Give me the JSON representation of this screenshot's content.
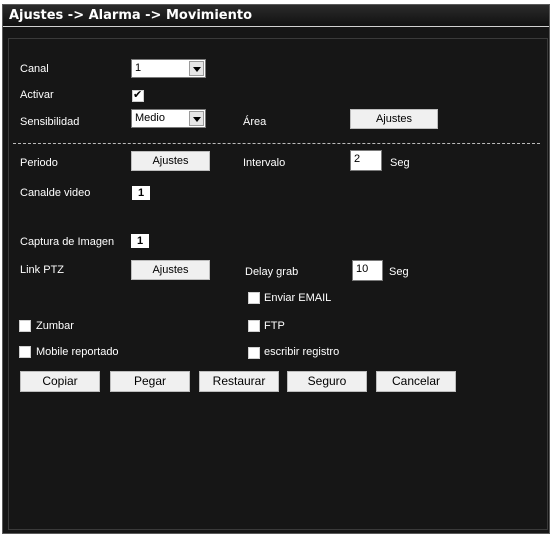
{
  "title": "Ajustes -> Alarma -> Movimiento",
  "canal": {
    "label": "Canal",
    "value": "1"
  },
  "activar": {
    "label": "Activar",
    "checked": true
  },
  "sensibilidad": {
    "label": "Sensibilidad",
    "value": "Medio"
  },
  "area": {
    "label": "Área",
    "button": "Ajustes"
  },
  "periodo": {
    "label": "Periodo",
    "button": "Ajustes"
  },
  "intervalo": {
    "label": "Intervalo",
    "value": "2",
    "unit": "Seg"
  },
  "canal_video": {
    "label": "Canalde video",
    "value": "1"
  },
  "captura": {
    "label": "Captura de Imagen",
    "value": "1"
  },
  "link_ptz": {
    "label": "Link PTZ",
    "button": "Ajustes"
  },
  "delay_grab": {
    "label": "Delay grab",
    "value": "10",
    "unit": "Seg"
  },
  "checkboxes": {
    "enviar_email": {
      "label": "Enviar EMAIL",
      "checked": false
    },
    "zumbar": {
      "label": "Zumbar",
      "checked": false
    },
    "ftp": {
      "label": "FTP",
      "checked": false
    },
    "mobile": {
      "label": "Mobile reportado",
      "checked": false
    },
    "registro": {
      "label": "escribir registro",
      "checked": false
    }
  },
  "actions": {
    "copiar": "Copiar",
    "pegar": "Pegar",
    "restaurar": "Restaurar",
    "seguro": "Seguro",
    "cancelar": "Cancelar"
  }
}
